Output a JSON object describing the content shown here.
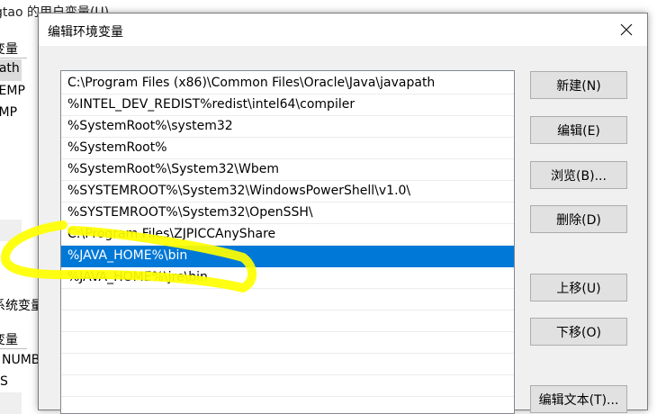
{
  "background_window": {
    "title": "gtao 的用户变量(U)",
    "upper_header": "变量",
    "upper_items": [
      "Path",
      "TEMP",
      "TMP"
    ],
    "lower_title": "系统变量(",
    "lower_header": "变量",
    "lower_items": [
      "NUMBE",
      "OS"
    ]
  },
  "dialog": {
    "title": "编辑环境变量",
    "list_items": [
      "C:\\Program Files (x86)\\Common Files\\Oracle\\Java\\javapath",
      "%INTEL_DEV_REDIST%redist\\intel64\\compiler",
      "%SystemRoot%\\system32",
      "%SystemRoot%",
      "%SystemRoot%\\System32\\Wbem",
      "%SYSTEMROOT%\\System32\\WindowsPowerShell\\v1.0\\",
      "%SYSTEMROOT%\\System32\\OpenSSH\\",
      "C:\\Program Files\\ZJPICCAnyShare",
      "%JAVA_HOME%\\bin",
      "%JAVA_HOME%\\jre\\bin"
    ],
    "selected_index": 8,
    "buttons": {
      "new": "新建(N)",
      "edit": "编辑(E)",
      "browse": "浏览(B)...",
      "delete": "删除(D)",
      "move_up": "上移(U)",
      "move_down": "下移(O)",
      "edit_text": "编辑文本(T)..."
    }
  },
  "colors": {
    "selection": "#0078d7",
    "highlighter": "#ffff00"
  }
}
